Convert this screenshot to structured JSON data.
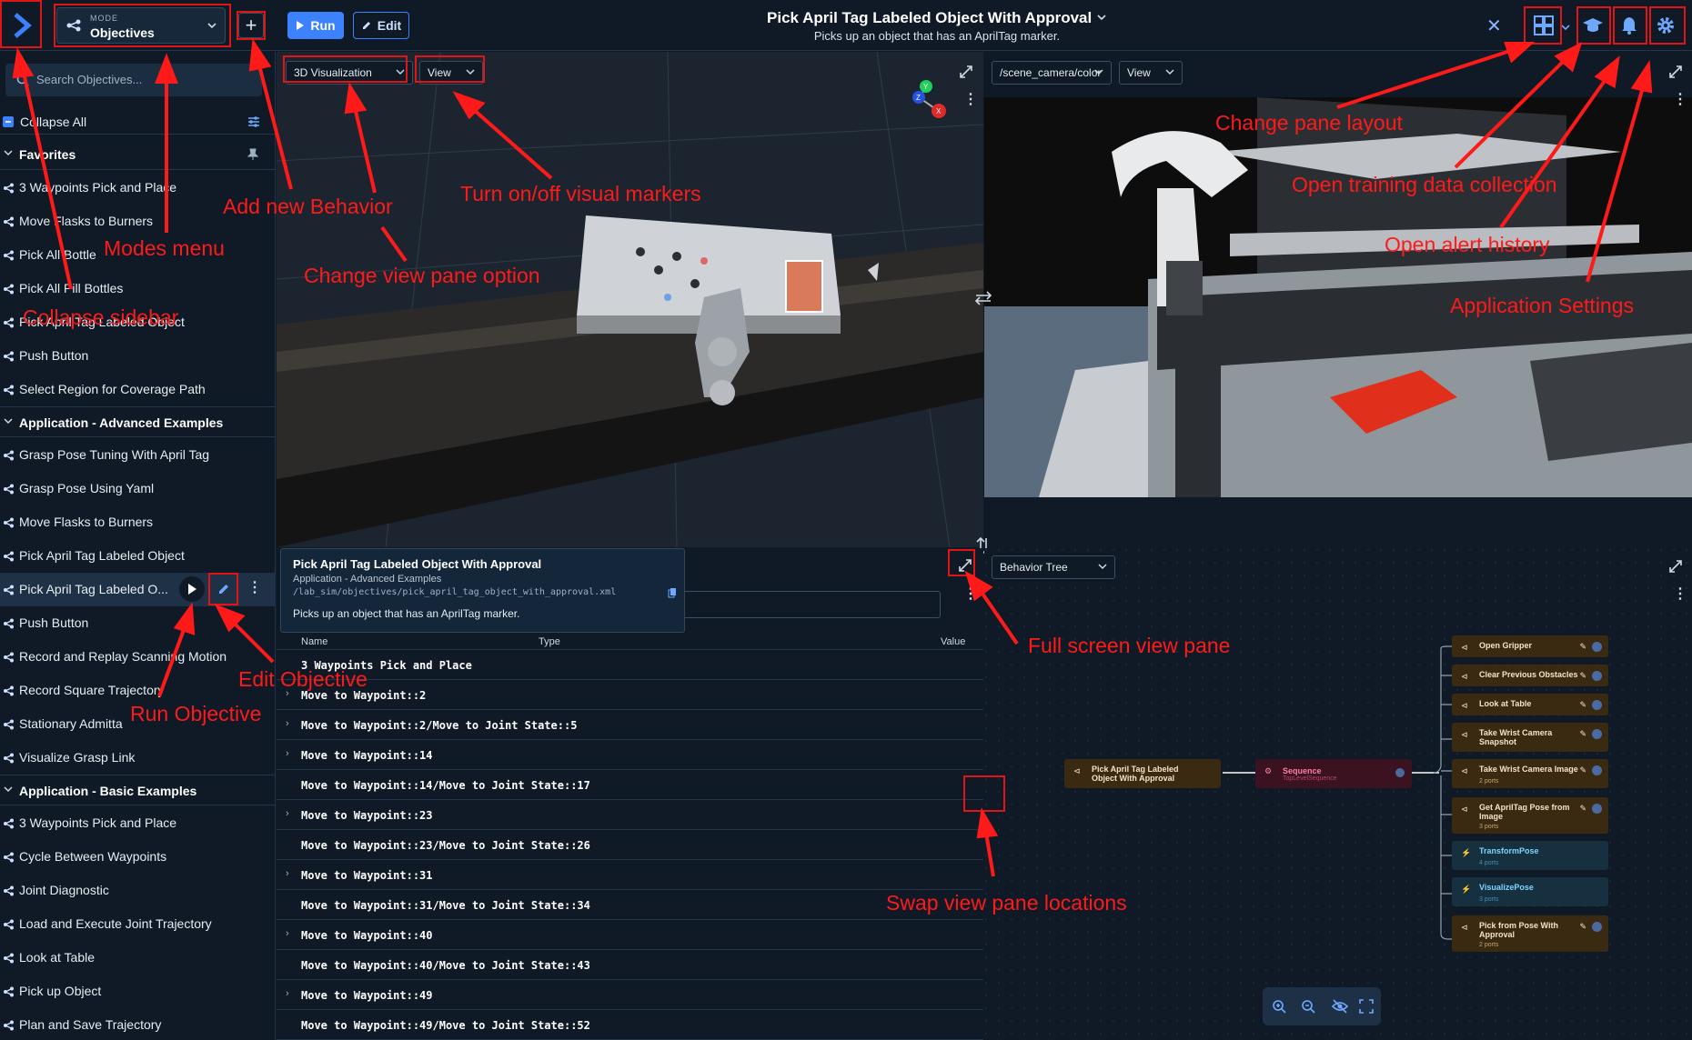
{
  "header": {
    "mode_caption": "MODE",
    "mode_value": "Objectives",
    "run_label": "Run",
    "edit_label": "Edit",
    "title": "Pick April Tag Labeled Object With Approval",
    "subtitle": "Picks up an object that has an AprilTag marker.",
    "close_icon": "close-icon",
    "layout_icon": "layout-grid-icon",
    "training_icon": "graduation-cap-icon",
    "alert_icon": "bell-icon",
    "settings_icon": "gear-icon"
  },
  "sidebar": {
    "search_placeholder": "Search Objectives...",
    "collapse_all": "Collapse All",
    "favorites": {
      "title": "Favorites",
      "items": [
        "3 Waypoints Pick and Place",
        "Move Flasks to Burners",
        "Pick All Bottle",
        "Pick All Pill Bottles",
        "Pick April Tag Labeled Object",
        "Push Button",
        "Select Region for Coverage Path"
      ]
    },
    "advanced": {
      "title": "Application - Advanced Examples",
      "items": [
        "Grasp Pose Tuning With April Tag",
        "Grasp Pose Using Yaml",
        "Move Flasks to Burners",
        "Pick April Tag Labeled Object",
        "Pick April Tag Labeled O...",
        "Push Button",
        "Record and Replay Scanning Motion",
        "Record Square Trajectory",
        "Stationary Admitta",
        "Visualize Grasp Link"
      ]
    },
    "basic": {
      "title": "Application - Basic Examples",
      "items": [
        "3 Waypoints Pick and Place",
        "Cycle Between Waypoints",
        "Joint Diagnostic",
        "Load and Execute Joint Trajectory",
        "Look at Table",
        "Pick up Object",
        "Plan and Save Trajectory"
      ]
    }
  },
  "pane_3d": {
    "selector": "3D Visualization",
    "view": "View",
    "axis_x": "X",
    "axis_y": "Y",
    "axis_z": "Z"
  },
  "pane_camera": {
    "selector": "/scene_camera/color",
    "view": "View"
  },
  "pane_blackboard": {
    "tooltip_title": "Pick April Tag Labeled Object With Approval",
    "tooltip_category": "Application - Advanced Examples",
    "tooltip_path": "/lab_sim/objectives/pick_april_tag_object_with_approval.xml",
    "tooltip_desc": "Picks up an object that has an AprilTag marker.",
    "col_name": "Name",
    "col_type": "Type",
    "col_value": "Value",
    "rows": [
      {
        "arrow": "",
        "name": "3 Waypoints Pick and Place"
      },
      {
        "arrow": "›",
        "name": "Move to Waypoint::2"
      },
      {
        "arrow": "›",
        "name": "Move to Waypoint::2/Move to Joint State::5"
      },
      {
        "arrow": "›",
        "name": "Move to Waypoint::14"
      },
      {
        "arrow": "",
        "name": "Move to Waypoint::14/Move to Joint State::17"
      },
      {
        "arrow": "›",
        "name": "Move to Waypoint::23"
      },
      {
        "arrow": "",
        "name": "Move to Waypoint::23/Move to Joint State::26"
      },
      {
        "arrow": "›",
        "name": "Move to Waypoint::31"
      },
      {
        "arrow": "",
        "name": "Move to Waypoint::31/Move to Joint State::34"
      },
      {
        "arrow": "›",
        "name": "Move to Waypoint::40"
      },
      {
        "arrow": "",
        "name": "Move to Waypoint::40/Move to Joint State::43"
      },
      {
        "arrow": "›",
        "name": "Move to Waypoint::49"
      },
      {
        "arrow": "",
        "name": "Move to Waypoint::49/Move to Joint State::52"
      }
    ]
  },
  "pane_tree": {
    "selector": "Behavior Tree",
    "root": "Pick April Tag Labeled Object With Approval",
    "sequence": "Sequence",
    "sequence_sub": "TopLevelSequence",
    "children": [
      {
        "title": "Open Gripper",
        "sub": ""
      },
      {
        "title": "Clear Previous Obstacles",
        "sub": ""
      },
      {
        "title": "Look at Table",
        "sub": ""
      },
      {
        "title": "Take Wrist Camera Snapshot",
        "sub": ""
      },
      {
        "title": "Take Wrist Camera Image",
        "sub": "2 ports"
      },
      {
        "title": "Get AprilTag Pose from Image",
        "sub": "3 ports"
      },
      {
        "title": "TransformPose",
        "sub": "4 ports"
      },
      {
        "title": "VisualizePose",
        "sub": "3 ports"
      },
      {
        "title": "Pick from Pose With Approval",
        "sub": "2 ports"
      }
    ]
  },
  "annotations": {
    "collapse_sidebar": "Collapse sidebar",
    "modes_menu": "Modes menu",
    "add_behavior": "Add new Behavior",
    "change_view_option": "Change view pane option",
    "visual_markers": "Turn on/off visual markers",
    "pane_layout": "Change pane layout",
    "training_data": "Open training data collection",
    "alert_history": "Open alert history",
    "app_settings": "Application Settings",
    "full_screen": "Full screen view pane",
    "swap_panes": "Swap view pane locations",
    "edit_objective": "Edit Objective",
    "run_objective": "Run Objective"
  },
  "colors": {
    "accent": "#3c82ff",
    "annotation": "#ff1a1a",
    "background": "#0f1a26"
  }
}
